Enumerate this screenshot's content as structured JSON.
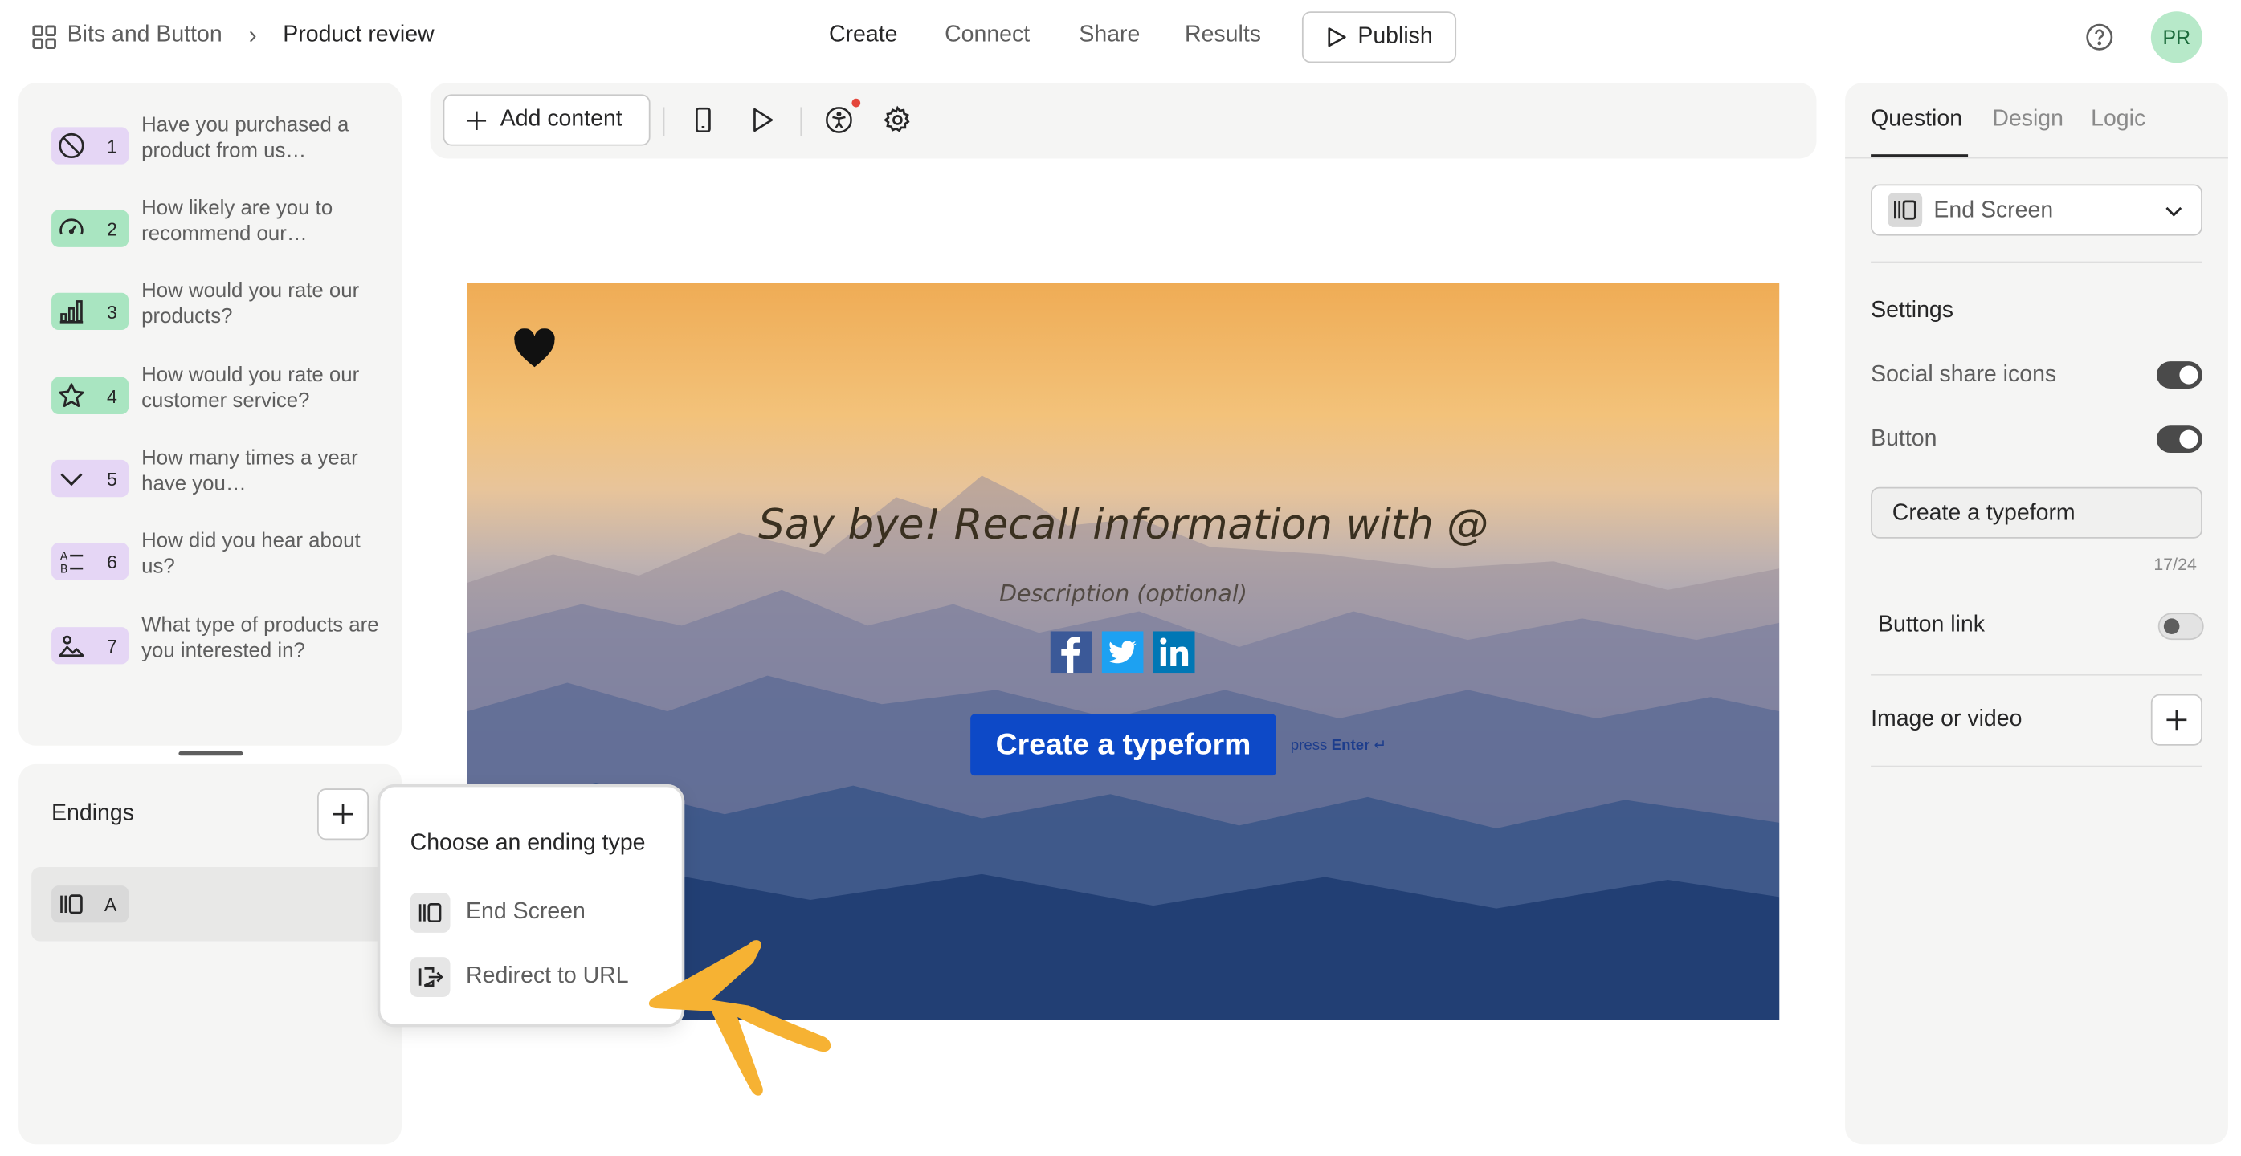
{
  "header": {
    "workspace": "Bits and Button",
    "breadcrumb_sep": "›",
    "form_name": "Product review",
    "nav": [
      "Create",
      "Connect",
      "Share",
      "Results"
    ],
    "publish_label": "Publish",
    "avatar_initials": "PR"
  },
  "questions": [
    {
      "num": "1",
      "text": "Have you purchased a product from us…",
      "icon": "no-entry-icon",
      "color": "#e5d6f5"
    },
    {
      "num": "2",
      "text": "How likely are you to recommend our…",
      "icon": "gauge-icon",
      "color": "#a9e5c1"
    },
    {
      "num": "3",
      "text": "How would you rate our products?",
      "icon": "bar-chart-icon",
      "color": "#a9e5c1"
    },
    {
      "num": "4",
      "text": "How would you rate our customer service?",
      "icon": "star-icon",
      "color": "#a9e5c1"
    },
    {
      "num": "5",
      "text": "How many times a year have you…",
      "icon": "chevron-down-icon",
      "color": "#e5d6f5"
    },
    {
      "num": "6",
      "text": "How did you hear about us?",
      "icon": "multiple-choice-icon",
      "color": "#e5d6f5"
    },
    {
      "num": "7",
      "text": "What type of products are you interested in?",
      "icon": "picture-choice-icon",
      "color": "#e5d6f5"
    }
  ],
  "endings": {
    "title": "Endings",
    "items": [
      {
        "label": "A",
        "icon": "end-screen-icon"
      }
    ]
  },
  "toolbar": {
    "add_content_label": "Add content"
  },
  "canvas": {
    "title": "Say bye! Recall information with @",
    "description": "Description (optional)",
    "button_label": "Create a typeform",
    "hint_press": "press",
    "hint_key": "Enter",
    "hint_arrow": "↵",
    "share_icons": [
      "facebook-icon",
      "twitter-icon",
      "linkedin-icon"
    ],
    "accent": "#0d49c7"
  },
  "popup": {
    "title": "Choose an ending type",
    "options": [
      {
        "label": "End Screen",
        "icon": "end-screen-icon"
      },
      {
        "label": "Redirect to URL",
        "icon": "redirect-icon"
      }
    ]
  },
  "right_panel": {
    "tabs": [
      "Question",
      "Design",
      "Logic"
    ],
    "type_select": "End Screen",
    "settings_title": "Settings",
    "social_share_label": "Social share icons",
    "social_share_on": true,
    "button_label": "Button",
    "button_on": true,
    "button_text_value": "Create a typeform",
    "char_count": "17/24",
    "button_link_label": "Button link",
    "button_link_on": false,
    "image_video_label": "Image or video"
  }
}
